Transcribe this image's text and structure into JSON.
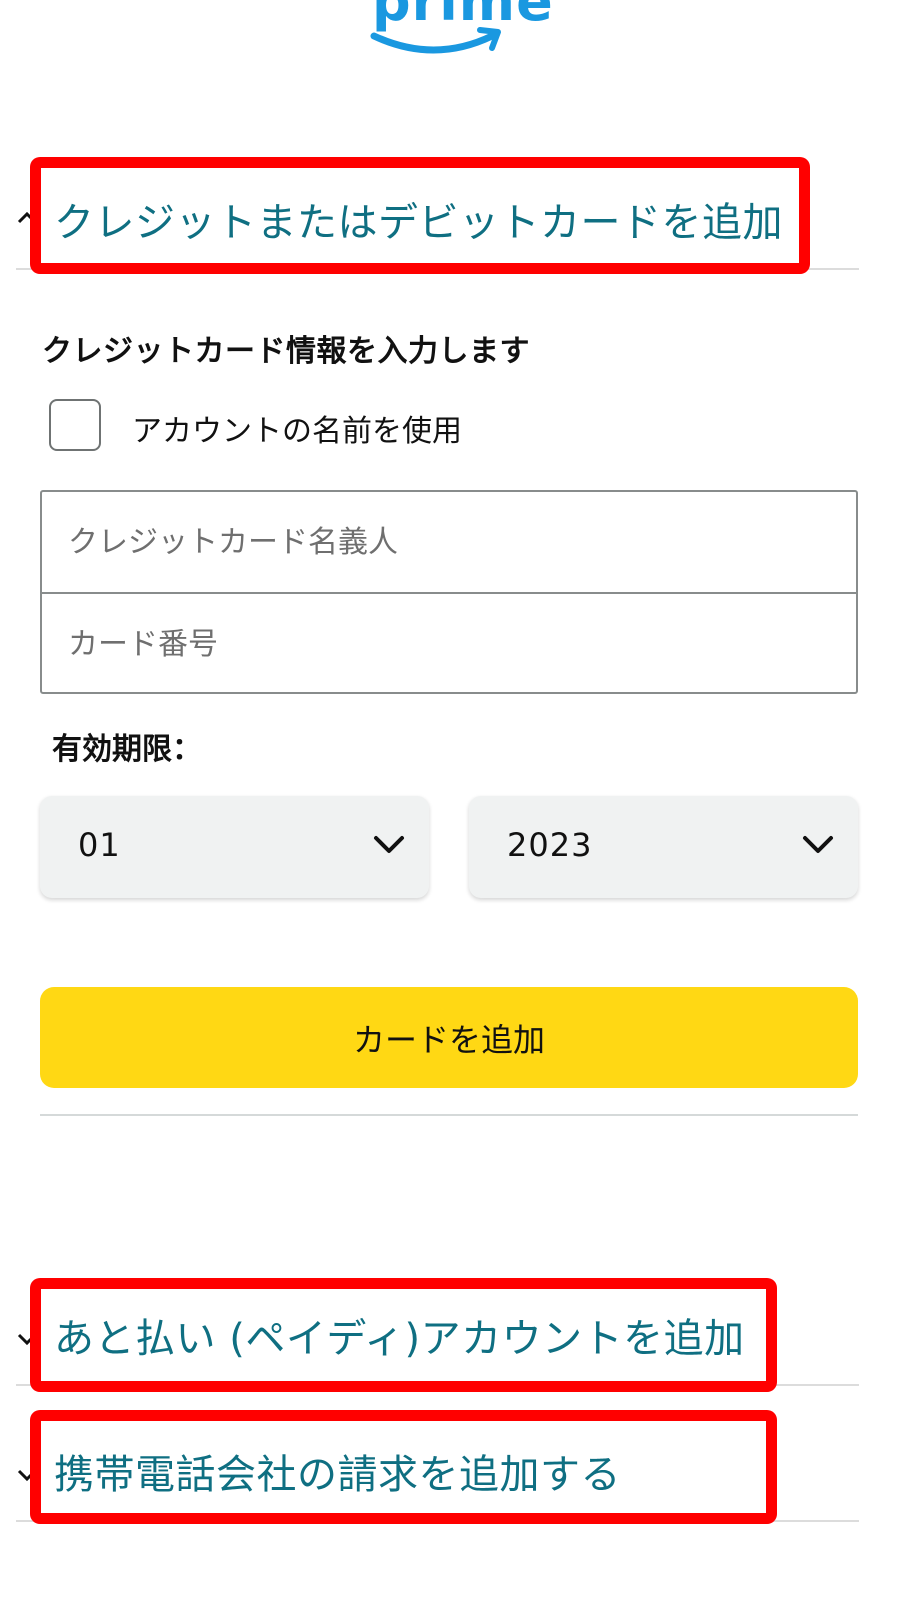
{
  "logo": {
    "text": "prime"
  },
  "credit_card_section": {
    "title": "クレジットまたはデビットカードを追加",
    "heading": "クレジットカード情報を入力します",
    "use_account_name_label": "アカウントの名前を使用",
    "cardholder_placeholder": "クレジットカード名義人",
    "card_number_placeholder": "カード番号",
    "expiry_label": "有効期限：",
    "expiry_month": "01",
    "expiry_year": "2023",
    "add_card_button": "カードを追加"
  },
  "other_options": [
    {
      "title": "あと払い (ペイディ)アカウントを追加"
    },
    {
      "title": "携帯電話会社の請求を追加する"
    }
  ],
  "colors": {
    "link_teal": "#0f6f82",
    "button_yellow": "#ffd814",
    "highlight_red": "#ff0000",
    "prime_blue": "#1a98e0"
  }
}
